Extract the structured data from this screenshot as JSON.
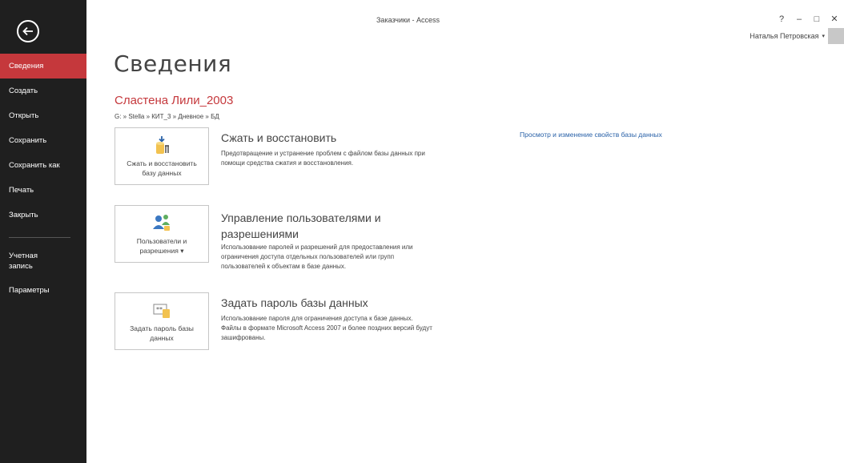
{
  "window": {
    "title": "Заказчики - Access"
  },
  "window_controls": {
    "help": "?",
    "minimize": "–",
    "restore": "□",
    "close": "✕"
  },
  "user": {
    "name": "Наталья Петровская",
    "dropdown": "▾"
  },
  "sidebar": {
    "back_icon": "back-arrow-icon",
    "items": [
      {
        "label": "Сведения",
        "active": true
      },
      {
        "label": "Создать"
      },
      {
        "label": "Открыть"
      },
      {
        "label": "Сохранить"
      },
      {
        "label": "Сохранить как"
      },
      {
        "label": "Печать"
      },
      {
        "label": "Закрыть"
      },
      {
        "label": "Учетная\nзапись"
      },
      {
        "label": "Параметры"
      }
    ]
  },
  "main": {
    "title": "Сведения",
    "db_name": "Сластена Лили_2003",
    "path": "G: » Stella » КИТ_3 » Дневное » БД",
    "properties_link": "Просмотр и изменение свойств базы данных",
    "sections": [
      {
        "button_label": "Сжать и восстановить\nбазу данных",
        "icon": "compact-repair-icon",
        "title": "Сжать и восстановить",
        "description": "Предотвращение и устранение проблем с файлом базы данных при\nпомощи средства сжатия и восстановления."
      },
      {
        "button_label": "Пользователи и\nразрешения ▾",
        "icon": "users-permissions-icon",
        "title": "Управление пользователями и\nразрешениями",
        "description": "Использование паролей и разрешений для предоставления или\nограничения доступа отдельных пользователей или групп\nпользователей к объектам в базе данных."
      },
      {
        "button_label": "Задать пароль базы\nданных",
        "icon": "password-icon",
        "title": "Задать пароль базы данных",
        "description": "Использование пароля для ограничения доступа к базе данных.\nФайлы в формате Microsoft Access 2007 и более поздних версий будут\nзашифрованы."
      }
    ]
  },
  "colors": {
    "sidebar_bg": "#1f1f1f",
    "accent": "#c5383c",
    "link": "#2a62a8"
  }
}
